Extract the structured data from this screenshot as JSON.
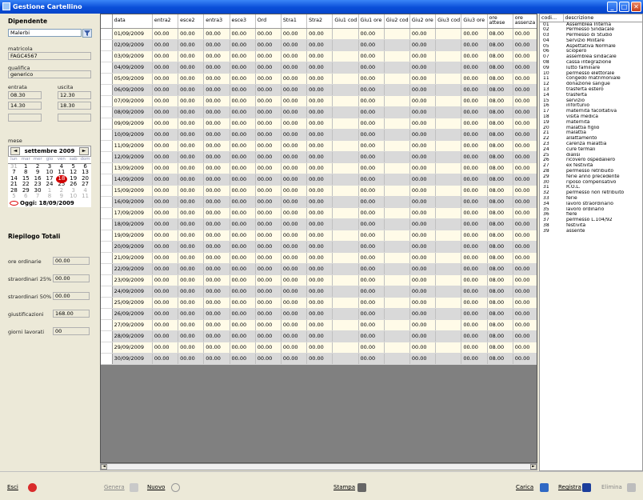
{
  "window": {
    "title": "Gestione Cartellino",
    "minimize": "_",
    "maximize": "□",
    "close": "✕"
  },
  "left": {
    "dipendente_label": "Dipendente",
    "dipendente_value": "Malerbi",
    "matricola_label": "matricola",
    "matricola_value": "FAGC4567",
    "qualifica_label": "qualifica",
    "qualifica_value": "generico",
    "entrata_label": "entrata",
    "uscita_label": "uscita",
    "entrata1": "08.30",
    "uscita1": "12.30",
    "entrata2": "14.30",
    "uscita2": "18.30",
    "mese_label": "mese",
    "calendar": {
      "prev": "◄",
      "next": "►",
      "month": "settembre 2009",
      "weekdays": [
        "lun",
        "mar",
        "mer",
        "gio",
        "ven",
        "sab",
        "dom"
      ],
      "cells": [
        "31",
        "1",
        "2",
        "3",
        "4",
        "5",
        "6",
        "7",
        "8",
        "9",
        "10",
        "11",
        "12",
        "13",
        "14",
        "15",
        "16",
        "17",
        "18",
        "19",
        "20",
        "21",
        "22",
        "23",
        "24",
        "25",
        "26",
        "27",
        "28",
        "29",
        "30",
        "1",
        "2",
        "3",
        "4",
        "5",
        "6",
        "7",
        "8",
        "9",
        "10",
        "11"
      ],
      "today": "Oggi: 18/09/2009"
    },
    "riepilogo_title": "Riepilogo Totali",
    "totals": [
      {
        "label": "ore ordinarie",
        "value": "00.00"
      },
      {
        "label": "straordinari 25%",
        "value": "00.00"
      },
      {
        "label": "straordinari 50%",
        "value": "00.00"
      },
      {
        "label": "giustificazioni",
        "value": "168.00"
      },
      {
        "label": "giorni lavorati",
        "value": "00"
      }
    ]
  },
  "grid": {
    "columns": [
      "data",
      "entra2",
      "esce2",
      "entra3",
      "esce3",
      "Ord",
      "Stra1",
      "Stra2",
      "Giu1 cod",
      "Giu1 ore",
      "Giu2 cod",
      "Giu2 ore",
      "Giu3 cod",
      "Giu3 ore",
      "ore attese",
      "ore assenza"
    ],
    "time_value": "00.00",
    "attese_value": "08.00",
    "dates": [
      "01/09/2009",
      "02/09/2009",
      "03/09/2009",
      "04/09/2009",
      "05/09/2009",
      "06/09/2009",
      "07/09/2009",
      "08/09/2009",
      "09/09/2009",
      "10/09/2009",
      "11/09/2009",
      "12/09/2009",
      "13/09/2009",
      "14/09/2009",
      "15/09/2009",
      "16/09/2009",
      "17/09/2009",
      "18/09/2009",
      "19/09/2009",
      "20/09/2009",
      "21/09/2009",
      "22/09/2009",
      "23/09/2009",
      "24/09/2009",
      "25/09/2009",
      "26/09/2009",
      "27/09/2009",
      "28/09/2009",
      "29/09/2009",
      "30/09/2009"
    ]
  },
  "codes": {
    "headers": [
      "codi...",
      "descrizione"
    ],
    "rows": [
      [
        "01",
        "Assemblea Interna"
      ],
      [
        "02",
        "Permesso Sindacale"
      ],
      [
        "03",
        "Permesso di Studio"
      ],
      [
        "04",
        "Servizio Militare"
      ],
      [
        "05",
        "Aspettativa Normale"
      ],
      [
        "06",
        "sciopero"
      ],
      [
        "07",
        "assemblea sindacale"
      ],
      [
        "08",
        "cassa integrazione"
      ],
      [
        "09",
        "lutto familiare"
      ],
      [
        "10",
        "permesso elettorale"
      ],
      [
        "11",
        "congedo matrimoniale"
      ],
      [
        "12",
        "donazione sangue"
      ],
      [
        "13",
        "trasferta estero"
      ],
      [
        "14",
        "trasferta"
      ],
      [
        "15",
        "servizio"
      ],
      [
        "16",
        "infortunio"
      ],
      [
        "17",
        "maternità facoltativa"
      ],
      [
        "18",
        "visita medica"
      ],
      [
        "19",
        "maternità"
      ],
      [
        "20",
        "malattia figlio"
      ],
      [
        "21",
        "malattia"
      ],
      [
        "22",
        "allattamento"
      ],
      [
        "23",
        "carenza malattia"
      ],
      [
        "24",
        "cure termali"
      ],
      [
        "25",
        "dialisi"
      ],
      [
        "26",
        "ricovero ospedaliero"
      ],
      [
        "27",
        "ex festività"
      ],
      [
        "28",
        "permesso retribuito"
      ],
      [
        "29",
        "ferie anno precedente"
      ],
      [
        "30",
        "riposo compensativo"
      ],
      [
        "31",
        "R.O.L."
      ],
      [
        "32",
        "permesso non retribuito"
      ],
      [
        "33",
        "ferie"
      ],
      [
        "34",
        "lavoro straordinario"
      ],
      [
        "35",
        "lavoro ordinario"
      ],
      [
        "36",
        "fiere"
      ],
      [
        "37",
        "permesso L.104/92"
      ],
      [
        "38",
        "festività"
      ],
      [
        "39",
        "assente"
      ]
    ]
  },
  "buttons": {
    "esci": "Esci",
    "genera": "Genera",
    "nuovo": "Nuovo",
    "stampa": "Stampa",
    "carica": "Carica",
    "registra": "Registra",
    "elimina": "Elimina"
  }
}
